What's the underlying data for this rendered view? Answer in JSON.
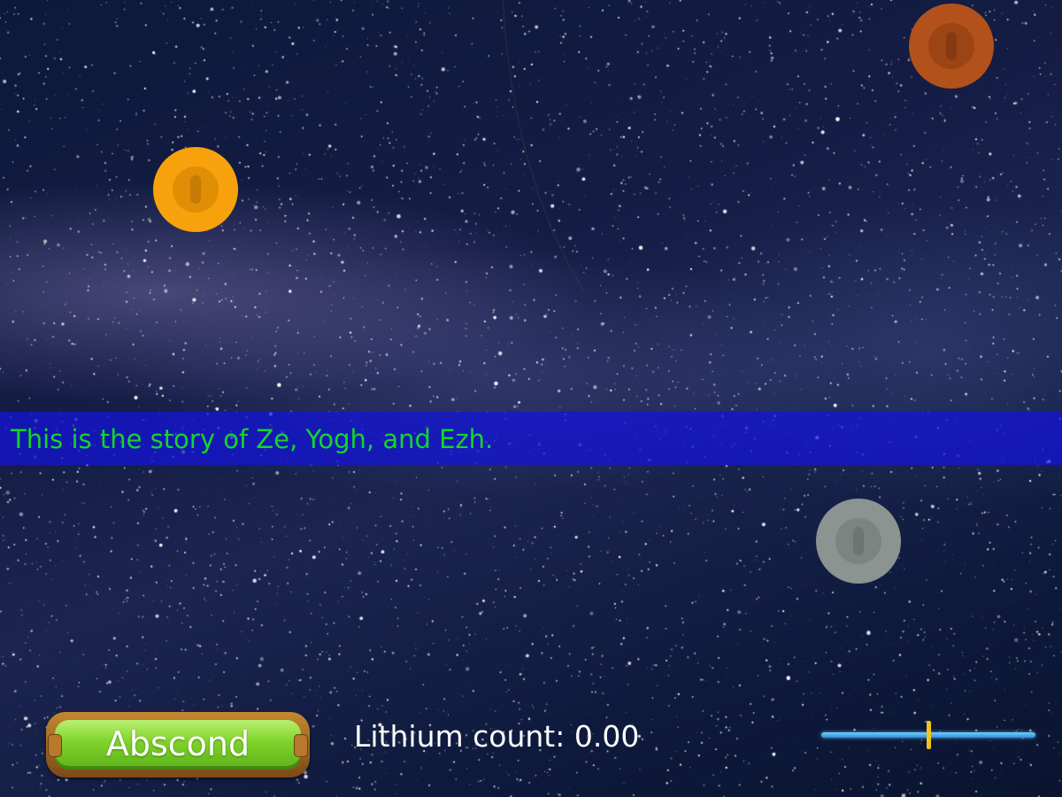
{
  "story": {
    "text": "This is the story of Ze, Yogh, and Ezh."
  },
  "coins": [
    {
      "name": "gold",
      "outer": "#f7a20c",
      "inner": "#e08e06",
      "slot": "#c77a04"
    },
    {
      "name": "copper",
      "outer": "#b2511a",
      "inner": "#9c4514",
      "slot": "#873a10"
    },
    {
      "name": "silver",
      "outer": "#8b9491",
      "inner": "#7b8481",
      "slot": "#6c7572"
    }
  ],
  "abscond_button": {
    "label": "Abscond"
  },
  "lithium": {
    "label": "Lithium count:",
    "value": "0.00"
  },
  "slider": {
    "level": 0.5
  },
  "colors": {
    "story_text": "#12d62a",
    "banner": "#1414dc",
    "slider_track": "#2a8fd8",
    "slider_handle": "#f2c318"
  }
}
